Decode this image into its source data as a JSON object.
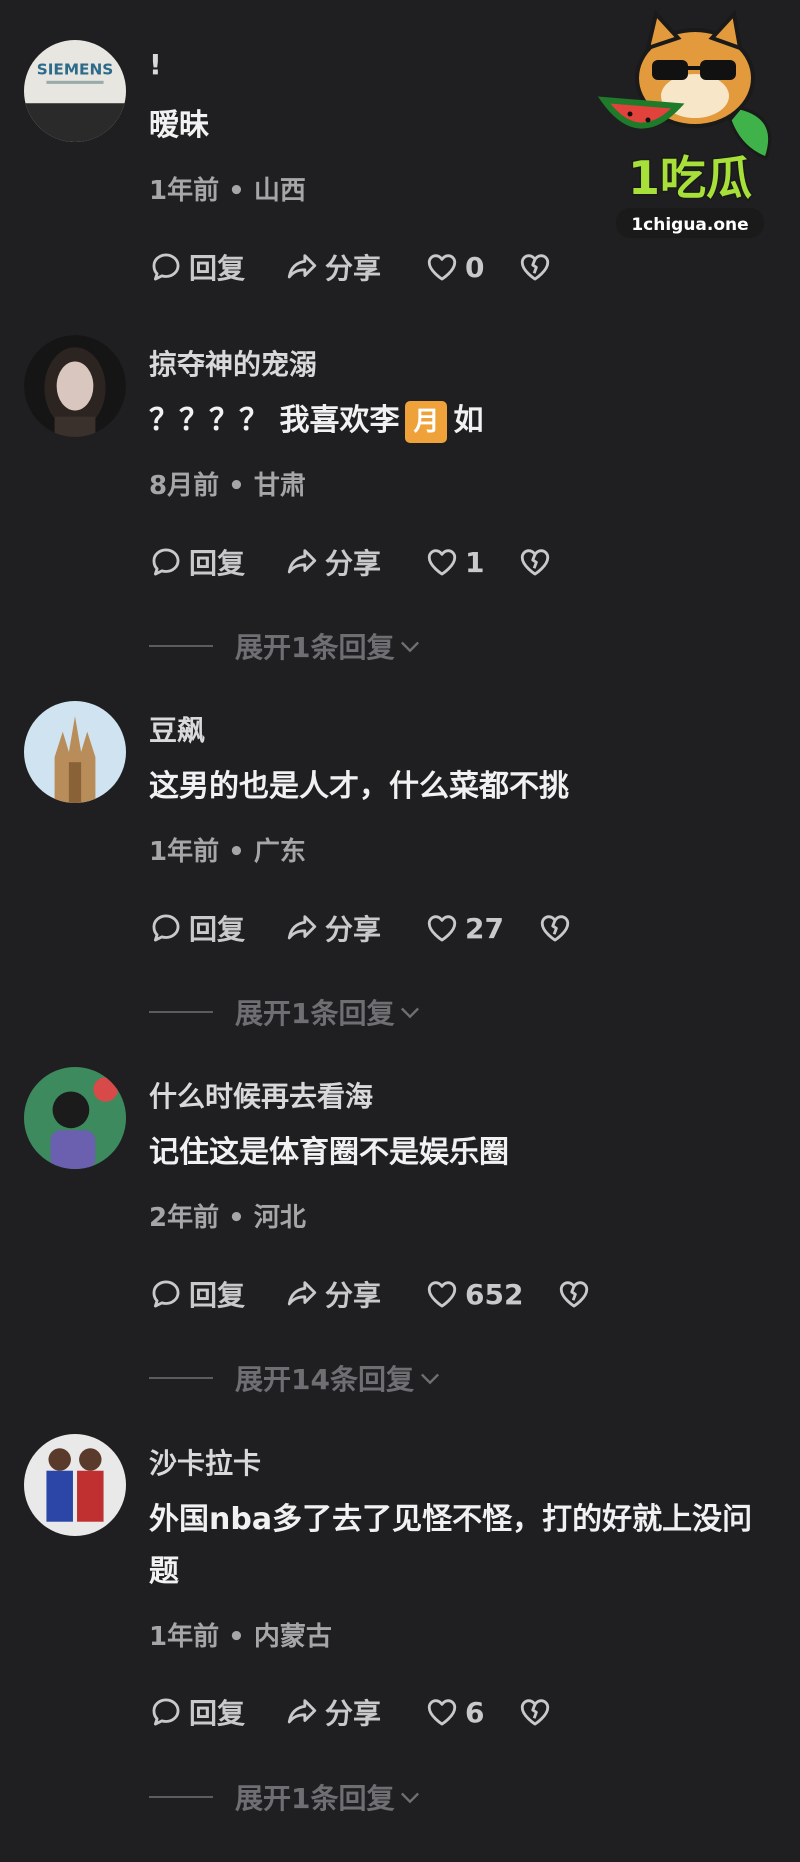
{
  "watermark": {
    "brand_cn": "1吃瓜",
    "url": "1chigua.one"
  },
  "comments": [
    {
      "username": "!",
      "avatar_text": "SIEMENS",
      "text": "暧昧",
      "meta": "1年前 • 山西",
      "reply_label": "回复",
      "share_label": "分享",
      "likes": "0",
      "expand": ""
    },
    {
      "username": "掠夺神的宠溺",
      "text_before": "？？？？ 我喜欢李",
      "badge": "月",
      "text_after": "如",
      "meta": "8月前 • 甘肃",
      "reply_label": "回复",
      "share_label": "分享",
      "likes": "1",
      "expand": "展开1条回复"
    },
    {
      "username": "豆飙",
      "text": "这男的也是人才，什么菜都不挑",
      "meta": "1年前 • 广东",
      "reply_label": "回复",
      "share_label": "分享",
      "likes": "27",
      "expand": "展开1条回复"
    },
    {
      "username": "什么时候再去看海",
      "text": "记住这是体育圈不是娱乐圈",
      "meta": "2年前 • 河北",
      "reply_label": "回复",
      "share_label": "分享",
      "likes": "652",
      "expand": "展开14条回复"
    },
    {
      "username": "沙卡拉卡",
      "text": "外国nba多了去了见怪不怪，打的好就上没问题",
      "meta": "1年前 • 内蒙古",
      "reply_label": "回复",
      "share_label": "分享",
      "likes": "6",
      "expand": "展开1条回复"
    }
  ],
  "colors": {
    "background": "#1f1f21",
    "badge": "#f0a23a",
    "text_primary": "#f1f1f2",
    "text_muted": "#a6a6a9"
  },
  "icons": [
    "comment-icon",
    "share-icon",
    "heart-icon",
    "broken-heart-icon",
    "chevron-down-icon"
  ]
}
